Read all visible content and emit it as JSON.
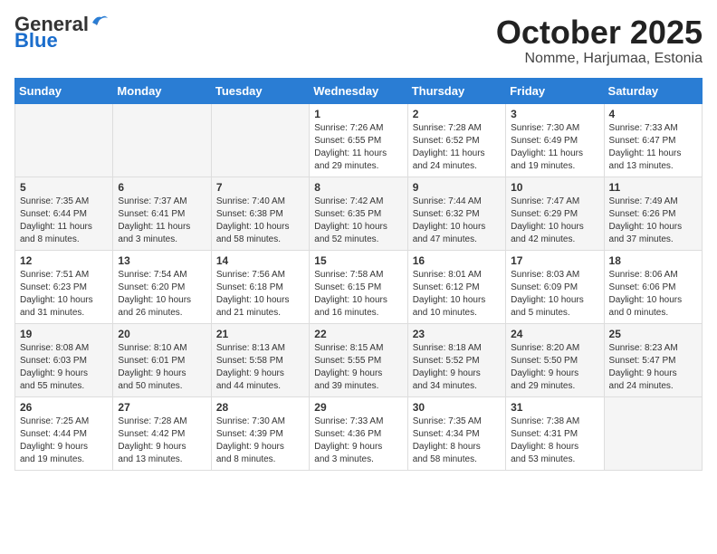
{
  "header": {
    "logo_general": "General",
    "logo_blue": "Blue",
    "month_title": "October 2025",
    "location": "Nomme, Harjumaa, Estonia"
  },
  "weekdays": [
    "Sunday",
    "Monday",
    "Tuesday",
    "Wednesday",
    "Thursday",
    "Friday",
    "Saturday"
  ],
  "weeks": [
    [
      {
        "day": "",
        "info": ""
      },
      {
        "day": "",
        "info": ""
      },
      {
        "day": "",
        "info": ""
      },
      {
        "day": "1",
        "info": "Sunrise: 7:26 AM\nSunset: 6:55 PM\nDaylight: 11 hours\nand 29 minutes."
      },
      {
        "day": "2",
        "info": "Sunrise: 7:28 AM\nSunset: 6:52 PM\nDaylight: 11 hours\nand 24 minutes."
      },
      {
        "day": "3",
        "info": "Sunrise: 7:30 AM\nSunset: 6:49 PM\nDaylight: 11 hours\nand 19 minutes."
      },
      {
        "day": "4",
        "info": "Sunrise: 7:33 AM\nSunset: 6:47 PM\nDaylight: 11 hours\nand 13 minutes."
      }
    ],
    [
      {
        "day": "5",
        "info": "Sunrise: 7:35 AM\nSunset: 6:44 PM\nDaylight: 11 hours\nand 8 minutes."
      },
      {
        "day": "6",
        "info": "Sunrise: 7:37 AM\nSunset: 6:41 PM\nDaylight: 11 hours\nand 3 minutes."
      },
      {
        "day": "7",
        "info": "Sunrise: 7:40 AM\nSunset: 6:38 PM\nDaylight: 10 hours\nand 58 minutes."
      },
      {
        "day": "8",
        "info": "Sunrise: 7:42 AM\nSunset: 6:35 PM\nDaylight: 10 hours\nand 52 minutes."
      },
      {
        "day": "9",
        "info": "Sunrise: 7:44 AM\nSunset: 6:32 PM\nDaylight: 10 hours\nand 47 minutes."
      },
      {
        "day": "10",
        "info": "Sunrise: 7:47 AM\nSunset: 6:29 PM\nDaylight: 10 hours\nand 42 minutes."
      },
      {
        "day": "11",
        "info": "Sunrise: 7:49 AM\nSunset: 6:26 PM\nDaylight: 10 hours\nand 37 minutes."
      }
    ],
    [
      {
        "day": "12",
        "info": "Sunrise: 7:51 AM\nSunset: 6:23 PM\nDaylight: 10 hours\nand 31 minutes."
      },
      {
        "day": "13",
        "info": "Sunrise: 7:54 AM\nSunset: 6:20 PM\nDaylight: 10 hours\nand 26 minutes."
      },
      {
        "day": "14",
        "info": "Sunrise: 7:56 AM\nSunset: 6:18 PM\nDaylight: 10 hours\nand 21 minutes."
      },
      {
        "day": "15",
        "info": "Sunrise: 7:58 AM\nSunset: 6:15 PM\nDaylight: 10 hours\nand 16 minutes."
      },
      {
        "day": "16",
        "info": "Sunrise: 8:01 AM\nSunset: 6:12 PM\nDaylight: 10 hours\nand 10 minutes."
      },
      {
        "day": "17",
        "info": "Sunrise: 8:03 AM\nSunset: 6:09 PM\nDaylight: 10 hours\nand 5 minutes."
      },
      {
        "day": "18",
        "info": "Sunrise: 8:06 AM\nSunset: 6:06 PM\nDaylight: 10 hours\nand 0 minutes."
      }
    ],
    [
      {
        "day": "19",
        "info": "Sunrise: 8:08 AM\nSunset: 6:03 PM\nDaylight: 9 hours\nand 55 minutes."
      },
      {
        "day": "20",
        "info": "Sunrise: 8:10 AM\nSunset: 6:01 PM\nDaylight: 9 hours\nand 50 minutes."
      },
      {
        "day": "21",
        "info": "Sunrise: 8:13 AM\nSunset: 5:58 PM\nDaylight: 9 hours\nand 44 minutes."
      },
      {
        "day": "22",
        "info": "Sunrise: 8:15 AM\nSunset: 5:55 PM\nDaylight: 9 hours\nand 39 minutes."
      },
      {
        "day": "23",
        "info": "Sunrise: 8:18 AM\nSunset: 5:52 PM\nDaylight: 9 hours\nand 34 minutes."
      },
      {
        "day": "24",
        "info": "Sunrise: 8:20 AM\nSunset: 5:50 PM\nDaylight: 9 hours\nand 29 minutes."
      },
      {
        "day": "25",
        "info": "Sunrise: 8:23 AM\nSunset: 5:47 PM\nDaylight: 9 hours\nand 24 minutes."
      }
    ],
    [
      {
        "day": "26",
        "info": "Sunrise: 7:25 AM\nSunset: 4:44 PM\nDaylight: 9 hours\nand 19 minutes."
      },
      {
        "day": "27",
        "info": "Sunrise: 7:28 AM\nSunset: 4:42 PM\nDaylight: 9 hours\nand 13 minutes."
      },
      {
        "day": "28",
        "info": "Sunrise: 7:30 AM\nSunset: 4:39 PM\nDaylight: 9 hours\nand 8 minutes."
      },
      {
        "day": "29",
        "info": "Sunrise: 7:33 AM\nSunset: 4:36 PM\nDaylight: 9 hours\nand 3 minutes."
      },
      {
        "day": "30",
        "info": "Sunrise: 7:35 AM\nSunset: 4:34 PM\nDaylight: 8 hours\nand 58 minutes."
      },
      {
        "day": "31",
        "info": "Sunrise: 7:38 AM\nSunset: 4:31 PM\nDaylight: 8 hours\nand 53 minutes."
      },
      {
        "day": "",
        "info": ""
      }
    ]
  ]
}
